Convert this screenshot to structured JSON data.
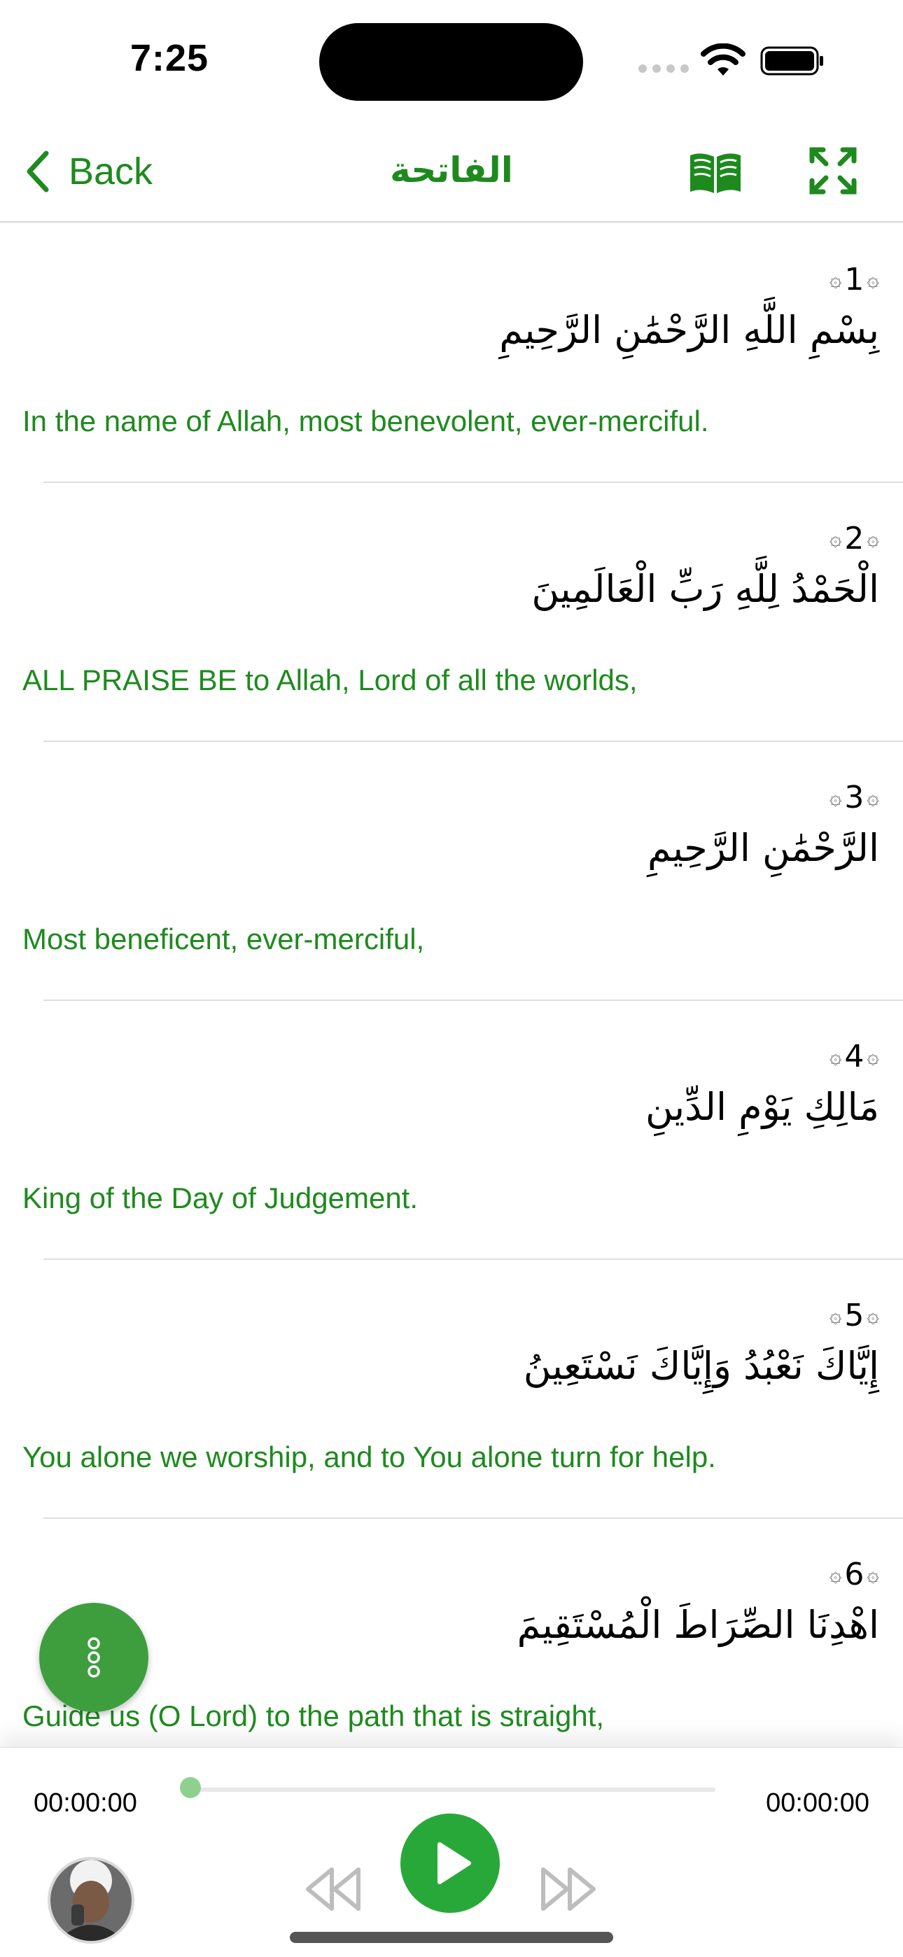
{
  "status_bar": {
    "time": "7:25",
    "icons": [
      "signal-icon",
      "wifi-icon",
      "battery-icon"
    ]
  },
  "nav": {
    "back_label": "Back",
    "title": "الفاتحة",
    "icons": [
      "chevron-left-icon",
      "book-icon",
      "fullscreen-icon"
    ]
  },
  "verses": [
    {
      "number": "1",
      "arabic": "بِسْمِ اللَّهِ الرَّحْمَٰنِ الرَّحِيمِ",
      "translation": "In the name of Allah, most benevolent, ever-merciful."
    },
    {
      "number": "2",
      "arabic": "الْحَمْدُ لِلَّهِ رَبِّ الْعَالَمِينَ",
      "translation": "ALL PRAISE BE to Allah, Lord of all the worlds,"
    },
    {
      "number": "3",
      "arabic": "الرَّحْمَٰنِ الرَّحِيمِ",
      "translation": "Most beneficent, ever-merciful,"
    },
    {
      "number": "4",
      "arabic": "مَالِكِ يَوْمِ الدِّينِ",
      "translation": "King of the Day of Judgement."
    },
    {
      "number": "5",
      "arabic": "إِيَّاكَ نَعْبُدُ وَإِيَّاكَ نَسْتَعِينُ",
      "translation": "You alone we worship, and to You alone turn for help."
    },
    {
      "number": "6",
      "arabic": "اهْدِنَا الصِّرَاطَ الْمُسْتَقِيمَ",
      "translation": "Guide us (O Lord) to the path that is straight,"
    }
  ],
  "verse_ornament": {
    "left": "۞",
    "right": "۞"
  },
  "fab": {
    "icon": "more-vertical-icon"
  },
  "player": {
    "current_time": "00:00:00",
    "total_time": "00:00:00",
    "progress_fraction": 0.0,
    "icons": [
      "rewind-icon",
      "play-icon",
      "fast-forward-icon",
      "reciter-avatar"
    ]
  },
  "colors": {
    "accent": "#1e8a1e",
    "play_button": "#29a83a",
    "fab": "#3e9e3e",
    "progress": "#8fd08f"
  }
}
